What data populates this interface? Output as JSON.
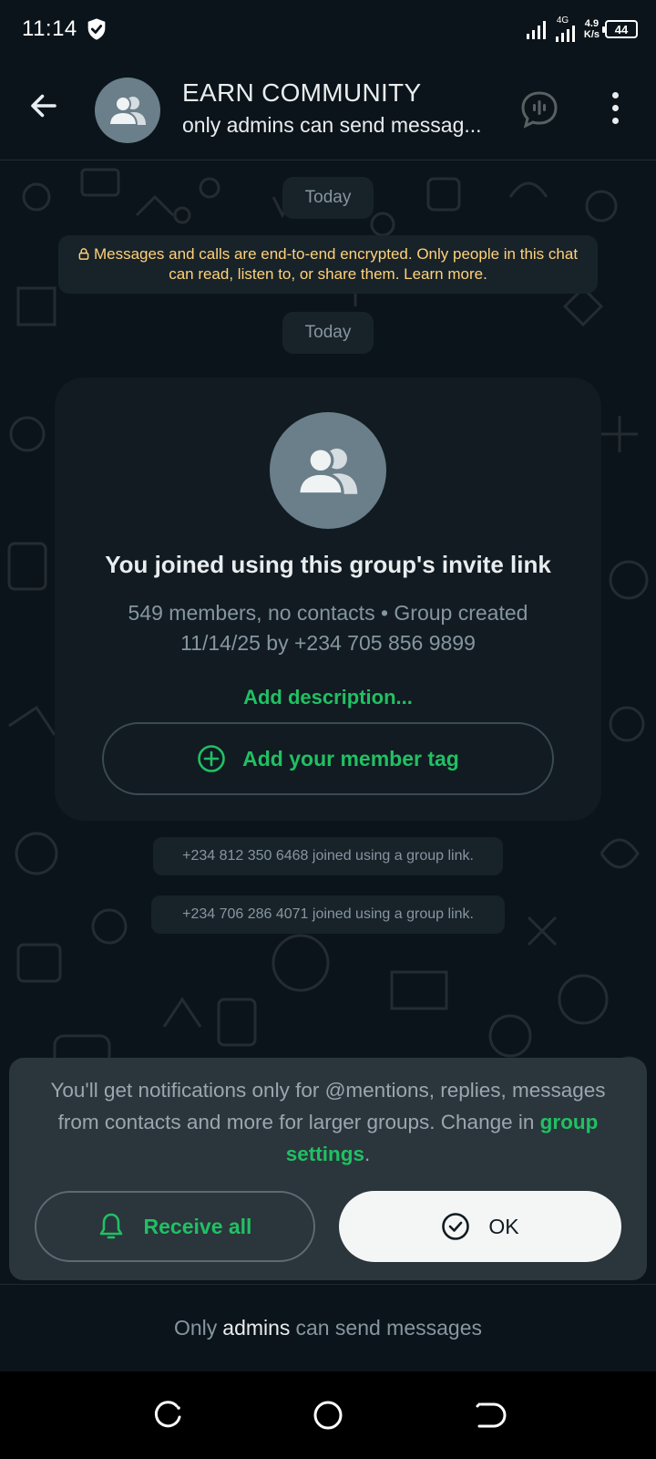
{
  "status_bar": {
    "time": "11:14",
    "network_type": "4G",
    "speed_value": "4.9",
    "speed_unit": "K/s",
    "battery": "44"
  },
  "header": {
    "group_name": "EARN COMMUNITY",
    "subtitle": "only admins can send messag..."
  },
  "chat": {
    "date_label_1": "Today",
    "encryption_notice": "Messages and calls are end-to-end encrypted. Only people in this chat can read, listen to, or share them. Learn more.",
    "date_label_2": "Today",
    "invite_card": {
      "title": "You joined using this group's invite link",
      "meta_line_1": "549 members, no contacts • Group created",
      "meta_line_2": "11/14/25 by +234 705 856 9899",
      "add_description": "Add description...",
      "member_tag_label": "Add your member tag"
    },
    "system_messages": [
      "+234 812 350 6468 joined using a group link.",
      "+234 706 286 4071 joined using a group link."
    ]
  },
  "notification_sheet": {
    "text_part_1": "You'll get notifications only for @mentions, replies, messages from contacts and more for larger groups. Change in",
    "link_text": "group settings",
    "text_part_2": ".",
    "receive_all_label": "Receive all",
    "ok_label": "OK"
  },
  "footer": {
    "prefix": "Only",
    "highlight": "admins",
    "suffix": "can send messages"
  },
  "colors": {
    "accent": "#21c063",
    "background": "#0b141a",
    "bubble": "#182229",
    "notice_text": "#ffd279"
  },
  "icons": [
    "shield-check-icon",
    "signal-icon",
    "battery-icon",
    "back-arrow-icon",
    "group-icon",
    "voice-chat-icon",
    "more-vert-icon",
    "lock-icon",
    "add-circle-icon",
    "bell-icon",
    "check-circle-icon",
    "recents-icon",
    "home-icon",
    "back-nav-icon"
  ]
}
